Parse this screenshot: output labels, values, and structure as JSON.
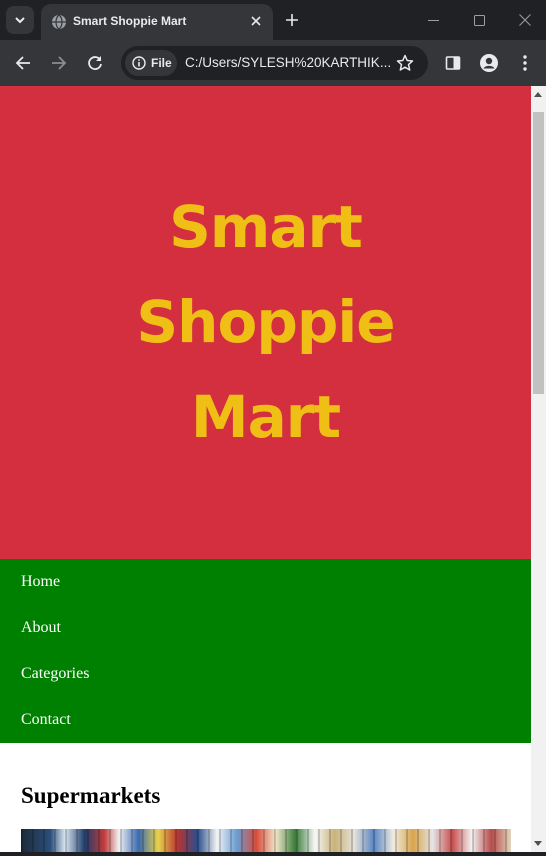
{
  "browser": {
    "tab_title": "Smart Shoppie Mart",
    "file_chip_label": "File",
    "url": "C:/Users/SYLESH%20KARTHIK..."
  },
  "icons": [
    "tab-search-icon",
    "globe-icon",
    "close-icon",
    "plus-icon",
    "minimize-icon",
    "maximize-icon",
    "close-window-icon",
    "back-arrow-icon",
    "forward-arrow-icon",
    "reload-icon",
    "info-icon",
    "star-icon",
    "side-panel-icon",
    "profile-icon",
    "menu-icon"
  ],
  "colors": {
    "hero_bg": "#d32f3f",
    "hero_text": "#efbf16",
    "nav_bg": "#008000",
    "nav_text": "#ffffff"
  },
  "hero": {
    "title": "Smart Shoppie Mart"
  },
  "nav": {
    "items": [
      {
        "label": "Home"
      },
      {
        "label": "About"
      },
      {
        "label": "Categories"
      },
      {
        "label": "Contact"
      }
    ]
  },
  "main": {
    "section_title": "Supermarkets"
  }
}
